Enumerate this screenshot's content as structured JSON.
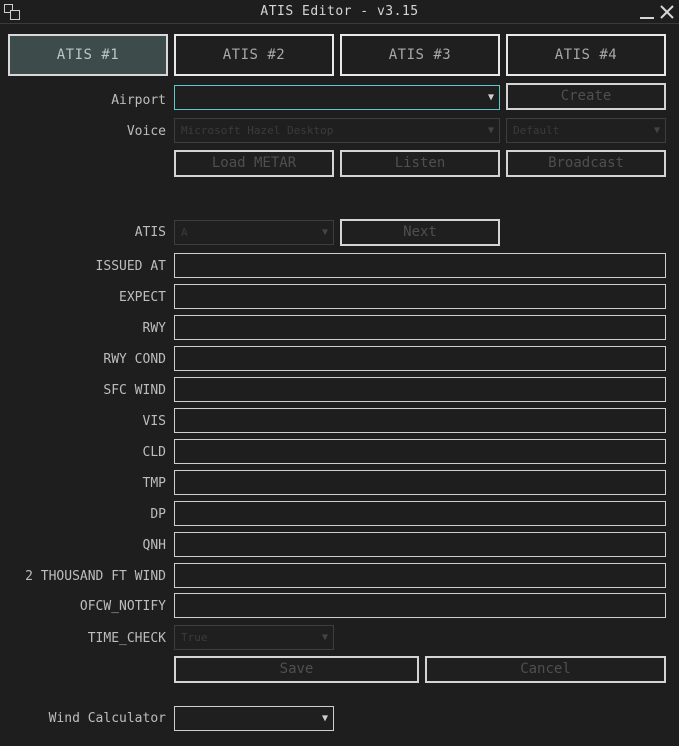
{
  "window": {
    "title": "ATIS Editor - v3.15"
  },
  "tabs": [
    {
      "label": "ATIS #1",
      "active": true
    },
    {
      "label": "ATIS #2",
      "active": false
    },
    {
      "label": "ATIS #3",
      "active": false
    },
    {
      "label": "ATIS #4",
      "active": false
    }
  ],
  "airport": {
    "label": "Airport",
    "value": "",
    "create_label": "Create"
  },
  "voice": {
    "label": "Voice",
    "value": "Microsoft Hazel Desktop",
    "secondary_value": "Default"
  },
  "actions": {
    "load_metar": "Load METAR",
    "listen": "Listen",
    "broadcast": "Broadcast"
  },
  "atis_row": {
    "label": "ATIS",
    "value": "A",
    "next_label": "Next"
  },
  "fields": [
    {
      "label": "ISSUED AT",
      "value": ""
    },
    {
      "label": "EXPECT",
      "value": ""
    },
    {
      "label": "RWY",
      "value": ""
    },
    {
      "label": "RWY COND",
      "value": ""
    },
    {
      "label": "SFC WIND",
      "value": ""
    },
    {
      "label": "VIS",
      "value": ""
    },
    {
      "label": "CLD",
      "value": ""
    },
    {
      "label": "TMP",
      "value": ""
    },
    {
      "label": "DP",
      "value": ""
    },
    {
      "label": "QNH",
      "value": ""
    },
    {
      "label": "2 THOUSAND FT WIND",
      "value": ""
    },
    {
      "label": "OFCW_NOTIFY",
      "value": ""
    }
  ],
  "time_check": {
    "label": "TIME_CHECK",
    "value": "True"
  },
  "footer": {
    "save_label": "Save",
    "cancel_label": "Cancel"
  },
  "wind_calculator": {
    "label": "Wind Calculator",
    "value": ""
  }
}
